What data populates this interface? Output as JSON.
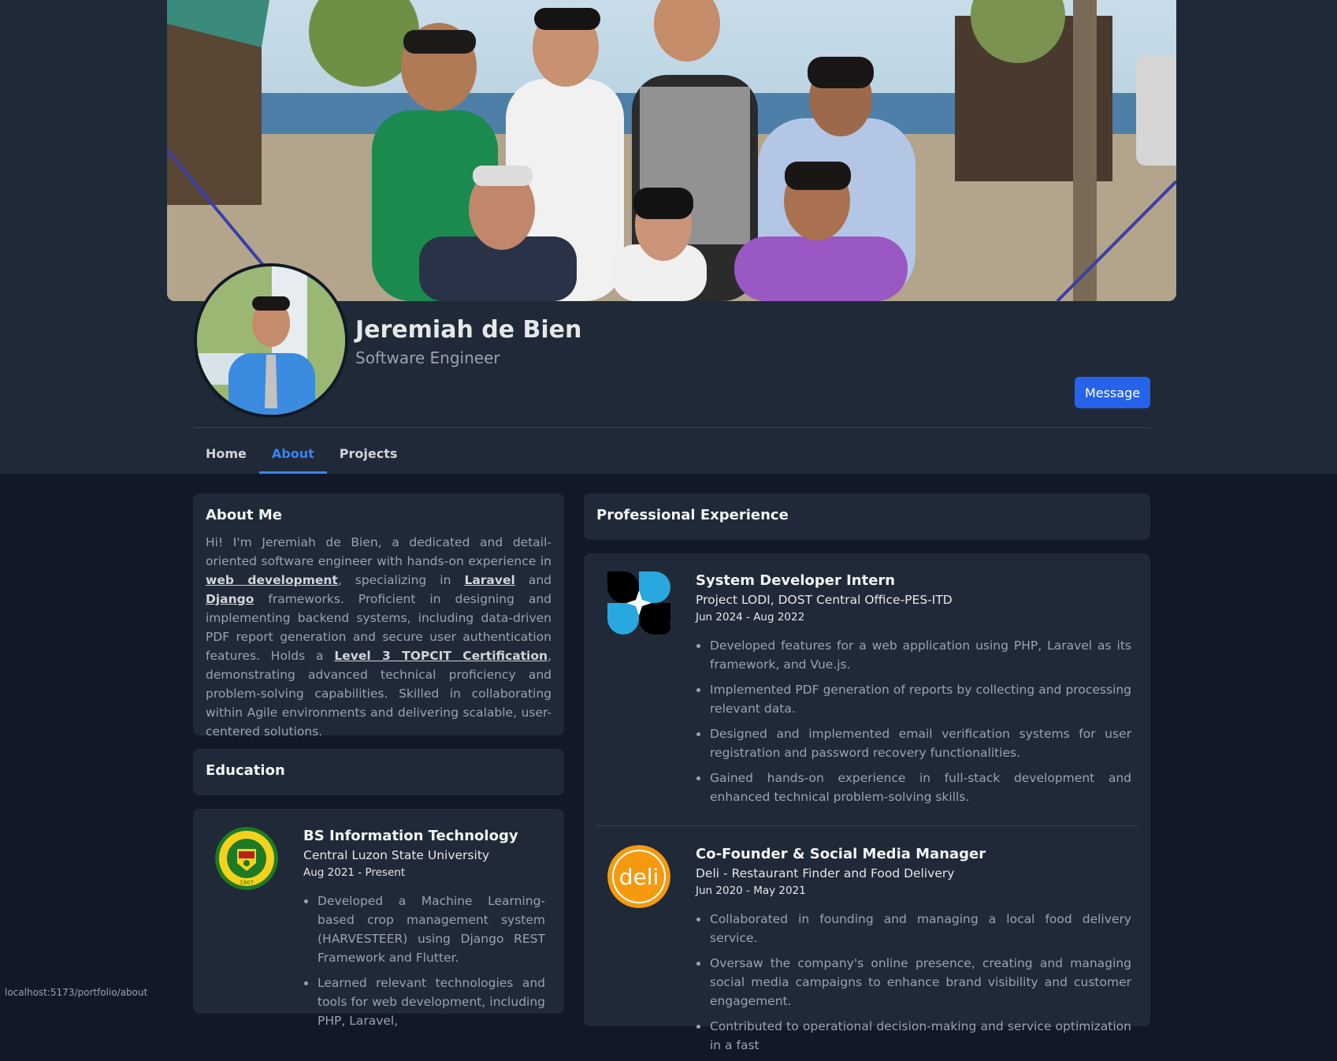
{
  "profile": {
    "name": "Jeremiah de Bien",
    "role": "Software Engineer",
    "message_label": "Message"
  },
  "tabs": [
    {
      "label": "Home",
      "active": false
    },
    {
      "label": "About",
      "active": true
    },
    {
      "label": "Projects",
      "active": false
    }
  ],
  "about": {
    "title": "About Me",
    "p1": "Hi! I'm Jeremiah de Bien, a dedicated and detail-oriented software engineer with hands-on experience in ",
    "link1": "web development",
    "p2": ", specializing in ",
    "link2": "Laravel",
    "p3": " and ",
    "link3": "Django",
    "p4": " frameworks. Proficient in designing and implementing backend systems, including data-driven PDF report generation and secure user authentication features. Holds a ",
    "link4": "Level 3 TOPCIT Certification",
    "p5": ", demonstrating advanced technical proficiency and problem-solving capabilities. Skilled in collaborating within Agile environments and delivering scalable, user-centered solutions."
  },
  "education": {
    "title": "Education",
    "entry": {
      "degree": "BS Information Technology",
      "school": "Central Luzon State University",
      "date": "Aug 2021 - Present",
      "logo_text": "CENTRAL LUZON STATE UNIVERSITY",
      "logo_year": "1907",
      "bullets": [
        "Developed a Machine Learning-based crop management system (HARVESTEER) using Django REST Framework and Flutter.",
        "Learned relevant technologies and tools for web development, including PHP, Laravel,"
      ]
    }
  },
  "experience": {
    "title": "Professional Experience",
    "entries": [
      {
        "title": "System Developer Intern",
        "org": "Project LODI, DOST Central Office-PES-ITD",
        "date": "Jun 2024 - Aug 2022",
        "bullets": [
          "Developed features for a web application using PHP, Laravel as its framework, and Vue.js.",
          "Implemented PDF generation of reports by collecting and processing relevant data.",
          "Designed and implemented email verification systems for user registration and password recovery functionalities.",
          "Gained hands-on experience in full-stack development and enhanced technical problem-solving skills."
        ]
      },
      {
        "title": "Co-Founder & Social Media Manager",
        "org": "Deli - Restaurant Finder and Food Delivery",
        "date": "Jun 2020 - May 2021",
        "logo_text": "deli",
        "bullets": [
          "Collaborated in founding and managing a local food delivery service.",
          "Oversaw the company's online presence, creating and managing social media campaigns to enhance brand visibility and customer engagement.",
          "Contributed to operational decision-making and service optimization in a fast"
        ]
      }
    ]
  },
  "status_url": "localhost:5173/portfolio/about",
  "colors": {
    "accent": "#2563eb",
    "tab_active": "#3b82f6",
    "card_bg": "#1f2937",
    "page_bg": "#111827"
  }
}
